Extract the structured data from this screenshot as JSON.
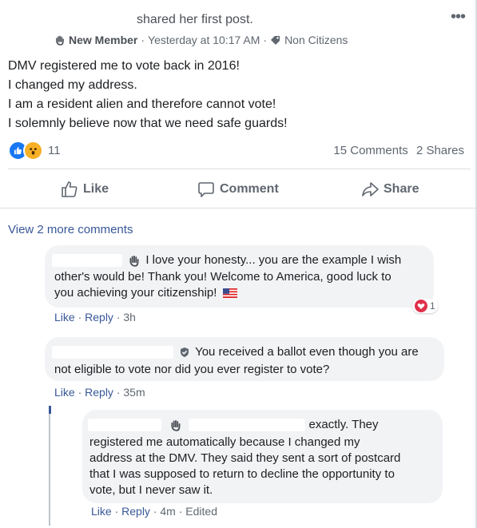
{
  "post": {
    "shared_text": "shared her first post.",
    "more_label": "•••",
    "badge_label": "New Member",
    "time": "Yesterday at 10:17 AM",
    "sep": "·",
    "topic": "Non Citizens",
    "lines": [
      "DMV registered me to vote back in 2016!",
      "I changed my address.",
      "I am a resident alien and therefore cannot vote!",
      "I solemnly believe now that we need safe guards!"
    ],
    "reaction_count": "11",
    "comments_count": "15 Comments",
    "shares_count": "2 Shares",
    "colors": {
      "like": "#1877f2",
      "wow": "#f7b125",
      "link": "#385898",
      "bubble": "#f2f3f5"
    }
  },
  "actions": {
    "like": "Like",
    "comment": "Comment",
    "share": "Share"
  },
  "view_more": "View 2 more comments",
  "comments": [
    {
      "text_l1": "I love your honesty... you are the example I wish",
      "text_l2": "other's would be! Thank you! Welcome to America, good luck to",
      "text_l3": "you achieving your citizenship!",
      "like": "Like",
      "reply": "Reply",
      "time": "3h",
      "reaction_count": "1"
    },
    {
      "text_l1": "You received a ballot even though you are",
      "text_l2": "not eligible to vote nor did you ever register to vote?",
      "like": "Like",
      "reply": "Reply",
      "time": "35m"
    },
    {
      "text_l1": "exactly. They",
      "text_l2": "registered me automatically because I changed my",
      "text_l3": "address at the DMV. They said they sent a sort of postcard",
      "text_l4": "that I was supposed to return to decline the opportunity to",
      "text_l5": "vote, but I never saw it.",
      "like": "Like",
      "reply": "Reply",
      "time": "4m",
      "edited": "Edited"
    }
  ]
}
